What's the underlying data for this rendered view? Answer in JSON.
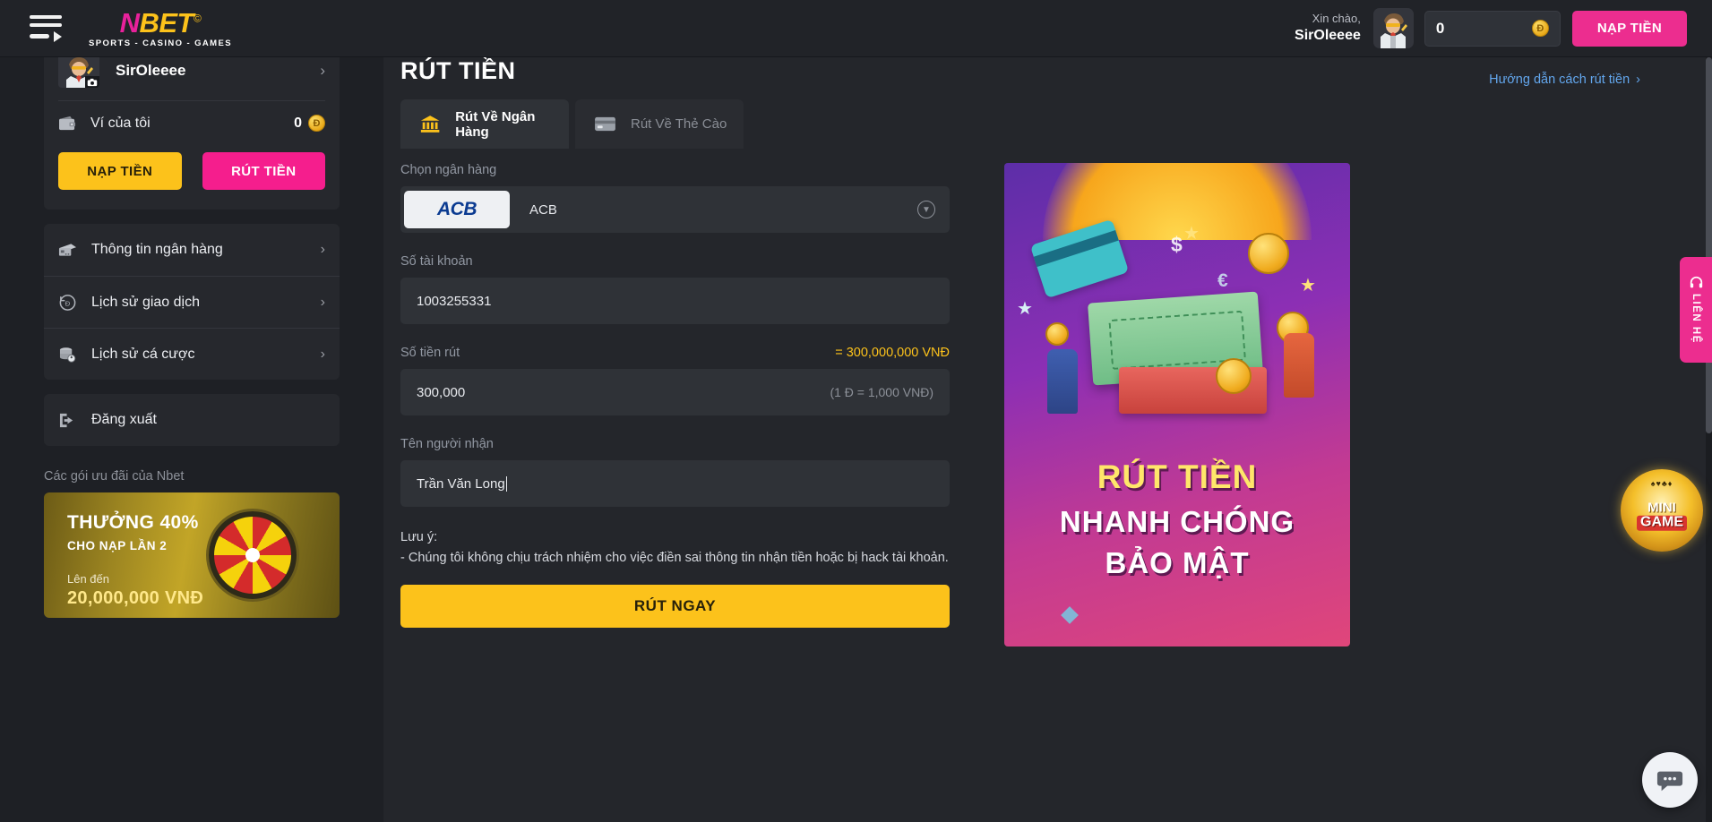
{
  "header": {
    "logo_main_n": "N",
    "logo_main_bet": "BET",
    "logo_copyright": "©",
    "logo_sub": "SPORTS - CASINO - GAMES",
    "greeting": "Xin chào,",
    "username": "SirOleeee",
    "balance": "0",
    "coin_symbol": "Đ",
    "deposit_button": "NẠP TIỀN"
  },
  "sidebar": {
    "profile_name": "SirOleeee",
    "wallet_label": "Ví của tôi",
    "wallet_amount": "0",
    "wallet_coin": "Đ",
    "deposit_button": "NẠP TIỀN",
    "withdraw_button": "RÚT TIỀN",
    "menu": [
      {
        "label": "Thông tin ngân hàng",
        "icon": "bank-card-icon"
      },
      {
        "label": "Lịch sử giao dịch",
        "icon": "history-clock-icon"
      },
      {
        "label": "Lịch sử cá cược",
        "icon": "coins-bet-icon"
      }
    ],
    "logout_label": "Đăng xuất",
    "promo_section_title": "Các gói ưu đãi của Nbet",
    "promo": {
      "headline": "THƯỞNG 40%",
      "subline": "CHO NẠP LẦN 2",
      "small": "Lên đến",
      "amount": "20,000,000 VNĐ"
    }
  },
  "main": {
    "page_title": "RÚT TIỀN",
    "guide_link": "Hướng dẫn cách rút tiền",
    "tabs": [
      {
        "label": "Rút Về Ngân Hàng",
        "icon": "bank-building-icon",
        "active": true
      },
      {
        "label": "Rút Về Thẻ Cào",
        "icon": "scratch-card-icon",
        "active": false
      }
    ],
    "form": {
      "bank_label": "Chọn ngân hàng",
      "bank_logo_text": "ACB",
      "bank_name": "ACB",
      "account_label": "Số tài khoản",
      "account_value": "1003255331",
      "amount_label": "Số tiền rút",
      "amount_equiv": "= 300,000,000 VNĐ",
      "amount_value": "300,000",
      "amount_rate": "(1 Đ = 1,000 VNĐ)",
      "recipient_label": "Tên người nhận",
      "recipient_value": "Trần Văn Long",
      "note_title": "Lưu ý:",
      "note_line": "- Chúng tôi không chịu trách nhiệm cho việc điền sai thông tin nhận tiền hoặc bị hack tài khoản.",
      "submit_button": "RÚT NGAY"
    },
    "ad": {
      "line1": "RÚT TIỀN",
      "line2": "NHANH CHÓNG",
      "line3": "BẢO MẬT"
    }
  },
  "floating": {
    "contact_label": "LIÊN HỆ",
    "minigame_cards": "♠♥♣♦",
    "minigame_mini": "MINI",
    "minigame_game": "GAME"
  },
  "colors": {
    "brand_pink": "#ec2d8f",
    "brand_yellow": "#fcc21b",
    "panel_bg": "#24262b",
    "sidebar_bg": "#1e2025",
    "card_bg": "#26282d",
    "input_bg": "#2f3237",
    "link_blue": "#63a7ee"
  }
}
